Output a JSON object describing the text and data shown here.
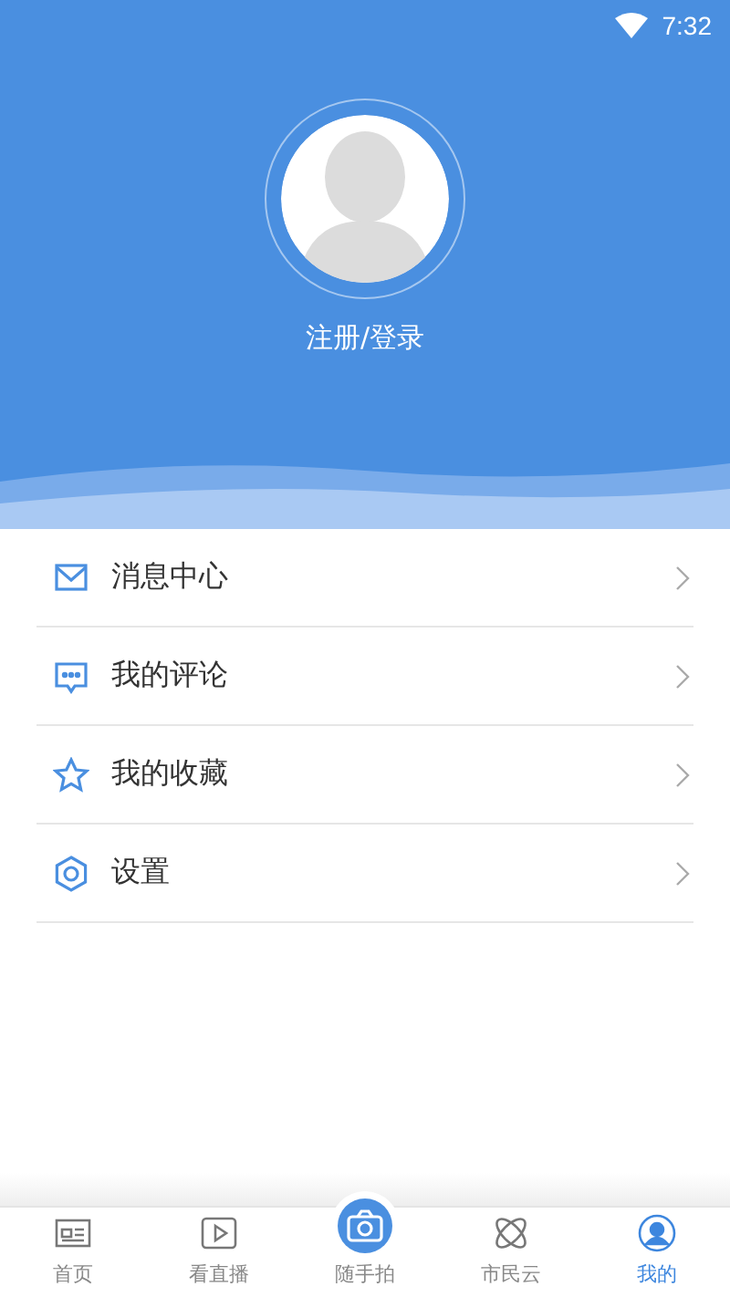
{
  "status_bar": {
    "time": "7:32"
  },
  "profile": {
    "login": "注册/登录"
  },
  "menu": [
    {
      "kind": "mail",
      "label": "消息中心"
    },
    {
      "kind": "comment",
      "label": "我的评论"
    },
    {
      "kind": "star",
      "label": "我的收藏"
    },
    {
      "kind": "gear",
      "label": "设置"
    }
  ],
  "tabs": [
    {
      "kind": "news",
      "label": "首页",
      "selected": false
    },
    {
      "kind": "video",
      "label": "看直播",
      "selected": false
    },
    {
      "kind": "camera",
      "label": "随手拍",
      "selected": false
    },
    {
      "kind": "orbit",
      "label": "市民云",
      "selected": false
    },
    {
      "kind": "user",
      "label": "我的",
      "selected": true
    }
  ]
}
